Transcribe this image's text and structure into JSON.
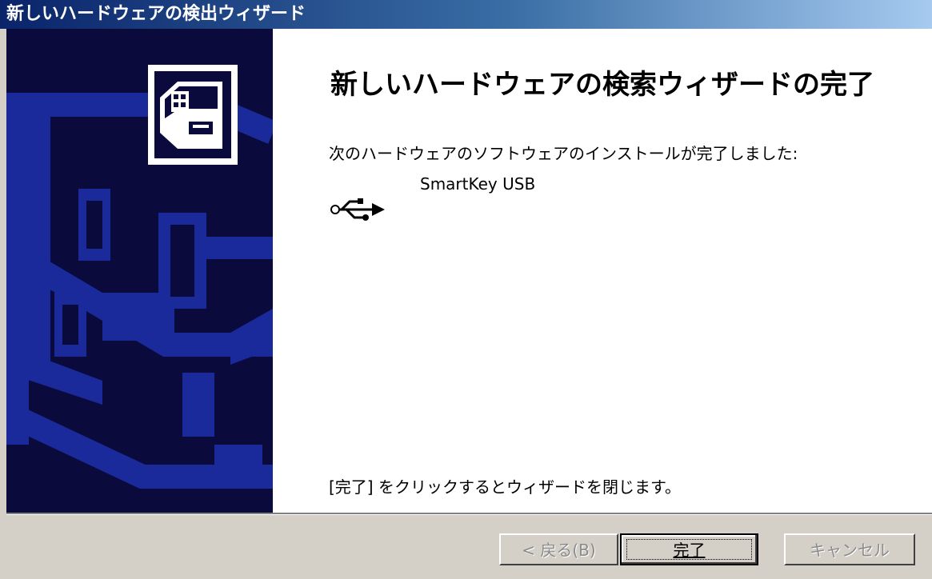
{
  "window": {
    "title": "新しいハードウェアの検出ウィザード"
  },
  "wizard": {
    "heading": "新しいハードウェアの検索ウィザードの完了",
    "subtext": "次のハードウェアのソフトウェアのインストールが完了しました:",
    "device": {
      "icon": "usb-icon",
      "name": "SmartKey USB"
    },
    "footer_text": "[完了] をクリックするとウィザードを閉じます。"
  },
  "buttons": {
    "back_label": "< 戻る(B)",
    "finish_label": "完了",
    "cancel_label": "キャンセル"
  },
  "colors": {
    "titlebar_start": "#0a246a",
    "titlebar_end": "#a6caf0",
    "side_panel": "#0a0a3c",
    "side_art": "#1a2a9a"
  }
}
